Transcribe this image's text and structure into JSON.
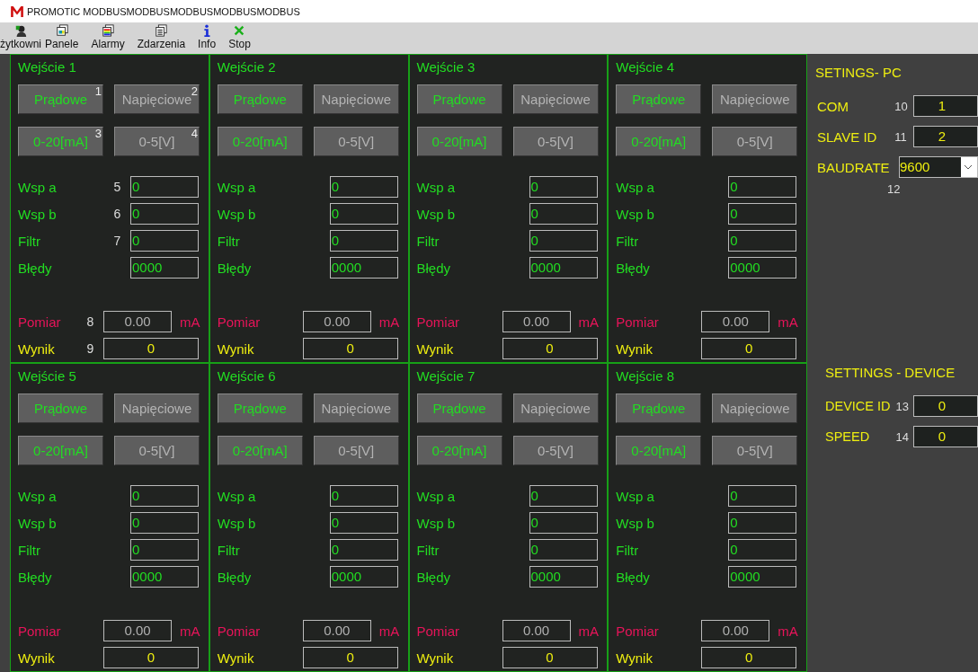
{
  "window": {
    "title": "PROMOTIC MODBUSMODBUSMODBUSMODBUSMODBUS"
  },
  "toolbar": [
    {
      "kind": "user",
      "label": "żytkowni"
    },
    {
      "kind": "panels",
      "label": "Panele"
    },
    {
      "kind": "alarms",
      "label": "Alarmy"
    },
    {
      "kind": "events",
      "label": "Zdarzenia"
    },
    {
      "kind": "info",
      "label": "Info"
    },
    {
      "kind": "stop",
      "label": "Stop"
    }
  ],
  "inputs": [
    {
      "title": "Wejście 1",
      "mode_buttons": [
        {
          "label": "Prądowe",
          "selected": true,
          "tag": "1"
        },
        {
          "label": "Napięciowe",
          "selected": false,
          "tag": "2"
        }
      ],
      "range_buttons": [
        {
          "label": "0-20[mA]",
          "selected": true,
          "tag": "3"
        },
        {
          "label": "0-5[V]",
          "selected": false,
          "tag": "4"
        }
      ],
      "params": [
        {
          "label": "Wsp a",
          "tag": "5",
          "value": "0"
        },
        {
          "label": "Wsp b",
          "tag": "6",
          "value": "0"
        },
        {
          "label": "Filtr",
          "tag": "7",
          "value": "0"
        },
        {
          "label": "Błędy",
          "value": "0000"
        }
      ],
      "measurement": {
        "label": "Pomiar",
        "tag": "8",
        "value": "0.00",
        "unit": "mA"
      },
      "result": {
        "label": "Wynik",
        "tag": "9",
        "value": "0"
      }
    },
    {
      "title": "Wejście 2",
      "mode_buttons": [
        {
          "label": "Prądowe",
          "selected": true
        },
        {
          "label": "Napięciowe",
          "selected": false
        }
      ],
      "range_buttons": [
        {
          "label": "0-20[mA]",
          "selected": true
        },
        {
          "label": "0-5[V]",
          "selected": false
        }
      ],
      "params": [
        {
          "label": "Wsp a",
          "value": "0"
        },
        {
          "label": "Wsp b",
          "value": "0"
        },
        {
          "label": "Filtr",
          "value": "0"
        },
        {
          "label": "Błędy",
          "value": "0000"
        }
      ],
      "measurement": {
        "label": "Pomiar",
        "value": "0.00",
        "unit": "mA"
      },
      "result": {
        "label": "Wynik",
        "value": "0"
      }
    },
    {
      "title": "Wejście 3",
      "mode_buttons": [
        {
          "label": "Prądowe",
          "selected": true
        },
        {
          "label": "Napięciowe",
          "selected": false
        }
      ],
      "range_buttons": [
        {
          "label": "0-20[mA]",
          "selected": true
        },
        {
          "label": "0-5[V]",
          "selected": false
        }
      ],
      "params": [
        {
          "label": "Wsp a",
          "value": "0"
        },
        {
          "label": "Wsp b",
          "value": "0"
        },
        {
          "label": "Filtr",
          "value": "0"
        },
        {
          "label": "Błędy",
          "value": "0000"
        }
      ],
      "measurement": {
        "label": "Pomiar",
        "value": "0.00",
        "unit": "mA"
      },
      "result": {
        "label": "Wynik",
        "value": "0"
      }
    },
    {
      "title": "Wejście 4",
      "mode_buttons": [
        {
          "label": "Prądowe",
          "selected": true
        },
        {
          "label": "Napięciowe",
          "selected": false
        }
      ],
      "range_buttons": [
        {
          "label": "0-20[mA]",
          "selected": true
        },
        {
          "label": "0-5[V]",
          "selected": false
        }
      ],
      "params": [
        {
          "label": "Wsp a",
          "value": "0"
        },
        {
          "label": "Wsp b",
          "value": "0"
        },
        {
          "label": "Filtr",
          "value": "0"
        },
        {
          "label": "Błędy",
          "value": "0000"
        }
      ],
      "measurement": {
        "label": "Pomiar",
        "value": "0.00",
        "unit": "mA"
      },
      "result": {
        "label": "Wynik",
        "value": "0"
      }
    },
    {
      "title": "Wejście 5",
      "mode_buttons": [
        {
          "label": "Prądowe",
          "selected": true
        },
        {
          "label": "Napięciowe",
          "selected": false
        }
      ],
      "range_buttons": [
        {
          "label": "0-20[mA]",
          "selected": true
        },
        {
          "label": "0-5[V]",
          "selected": false
        }
      ],
      "params": [
        {
          "label": "Wsp a",
          "value": "0"
        },
        {
          "label": "Wsp b",
          "value": "0"
        },
        {
          "label": "Filtr",
          "value": "0"
        },
        {
          "label": "Błędy",
          "value": "0000"
        }
      ],
      "measurement": {
        "label": "Pomiar",
        "value": "0.00",
        "unit": "mA"
      },
      "result": {
        "label": "Wynik",
        "value": "0"
      }
    },
    {
      "title": "Wejście 6",
      "mode_buttons": [
        {
          "label": "Prądowe",
          "selected": true
        },
        {
          "label": "Napięciowe",
          "selected": false
        }
      ],
      "range_buttons": [
        {
          "label": "0-20[mA]",
          "selected": true
        },
        {
          "label": "0-5[V]",
          "selected": false
        }
      ],
      "params": [
        {
          "label": "Wsp a",
          "value": "0"
        },
        {
          "label": "Wsp b",
          "value": "0"
        },
        {
          "label": "Filtr",
          "value": "0"
        },
        {
          "label": "Błędy",
          "value": "0000"
        }
      ],
      "measurement": {
        "label": "Pomiar",
        "value": "0.00",
        "unit": "mA"
      },
      "result": {
        "label": "Wynik",
        "value": "0"
      }
    },
    {
      "title": "Wejście 7",
      "mode_buttons": [
        {
          "label": "Prądowe",
          "selected": true
        },
        {
          "label": "Napięciowe",
          "selected": false
        }
      ],
      "range_buttons": [
        {
          "label": "0-20[mA]",
          "selected": true
        },
        {
          "label": "0-5[V]",
          "selected": false
        }
      ],
      "params": [
        {
          "label": "Wsp a",
          "value": "0"
        },
        {
          "label": "Wsp b",
          "value": "0"
        },
        {
          "label": "Filtr",
          "value": "0"
        },
        {
          "label": "Błędy",
          "value": "0000"
        }
      ],
      "measurement": {
        "label": "Pomiar",
        "value": "0.00",
        "unit": "mA"
      },
      "result": {
        "label": "Wynik",
        "value": "0"
      }
    },
    {
      "title": "Wejście 8",
      "mode_buttons": [
        {
          "label": "Prądowe",
          "selected": true
        },
        {
          "label": "Napięciowe",
          "selected": false
        }
      ],
      "range_buttons": [
        {
          "label": "0-20[mA]",
          "selected": true
        },
        {
          "label": "0-5[V]",
          "selected": false
        }
      ],
      "params": [
        {
          "label": "Wsp a",
          "value": "0"
        },
        {
          "label": "Wsp b",
          "value": "0"
        },
        {
          "label": "Filtr",
          "value": "0"
        },
        {
          "label": "Błędy",
          "value": "0000"
        }
      ],
      "measurement": {
        "label": "Pomiar",
        "value": "0.00",
        "unit": "mA"
      },
      "result": {
        "label": "Wynik",
        "value": "0"
      }
    }
  ],
  "settings_pc": {
    "title": "SETINGS- PC",
    "fields": [
      {
        "kind": "box",
        "label": "COM",
        "tag": "10",
        "value": "1"
      },
      {
        "kind": "box",
        "label": "SLAVE ID",
        "tag": "11",
        "value": "2"
      },
      {
        "kind": "dropdown",
        "label": "BAUDRATE",
        "tag": "12",
        "value": "9600"
      }
    ]
  },
  "settings_device": {
    "title": "SETTINGS - DEVICE",
    "fields": [
      {
        "kind": "box",
        "label": "DEVICE ID",
        "tag": "13",
        "value": "0"
      },
      {
        "kind": "box",
        "label": "SPEED",
        "tag": "14",
        "value": "0"
      }
    ]
  }
}
